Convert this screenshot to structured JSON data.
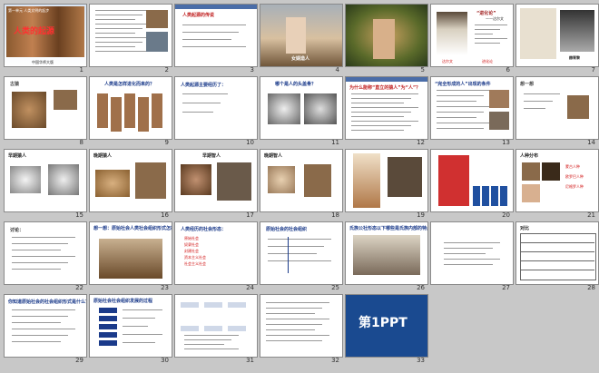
{
  "slides": [
    {
      "num": "1",
      "title": "人类的起源",
      "subtitle": "第一单元 人类文明的起步",
      "footer": "中国华师大版"
    },
    {
      "num": "2",
      "title": "",
      "lines": []
    },
    {
      "num": "3",
      "title": "人类起源的传说",
      "lines": [
        "",
        "",
        ""
      ]
    },
    {
      "num": "4",
      "caption": "女娲造人"
    },
    {
      "num": "5"
    },
    {
      "num": "6",
      "title": "“进化论”",
      "subtitle": "——达尔文",
      "caption1": "达尔文",
      "caption2": "进化论"
    },
    {
      "num": "7",
      "caption1": "",
      "caption2": "赫胥黎"
    },
    {
      "num": "8",
      "title": "古猿"
    },
    {
      "num": "9",
      "title": "人类是怎样进化而来的？"
    },
    {
      "num": "10",
      "title": "人类起源主要经历了：",
      "lines": [
        "",
        "",
        ""
      ]
    },
    {
      "num": "11",
      "title": "哪个是人的头盖骨？"
    },
    {
      "num": "12",
      "title": "为什么能称“直立的猿人”为“人”？"
    },
    {
      "num": "13",
      "title": "“完全形成的人”出现的条件"
    },
    {
      "num": "14",
      "title": "想一想",
      "lines": [
        "",
        "",
        ""
      ]
    },
    {
      "num": "15",
      "title": "早期猿人"
    },
    {
      "num": "16",
      "title": "晚期猿人"
    },
    {
      "num": "17",
      "title": "早期智人"
    },
    {
      "num": "18",
      "title": "晚期智人"
    },
    {
      "num": "19"
    },
    {
      "num": "20"
    },
    {
      "num": "21",
      "title": "人种分布",
      "lines": [
        "蒙古人种",
        "欧罗巴人种",
        "尼格罗人种"
      ]
    },
    {
      "num": "22",
      "title": "讨论："
    },
    {
      "num": "23",
      "title": "想一想：原始社会人类社会组织形式怎样？"
    },
    {
      "num": "24",
      "title": "人类经历的社会形态：",
      "lines": [
        "原始社会",
        "奴隶社会",
        "封建社会",
        "资本主义社会",
        "社会主义社会"
      ]
    },
    {
      "num": "25",
      "title": "原始社会的社会组织"
    },
    {
      "num": "26",
      "title": "氏族公社形态以下哪些是氏族内部的特点？"
    },
    {
      "num": "27"
    },
    {
      "num": "28",
      "title": "对比"
    },
    {
      "num": "29",
      "title": "你知道原始社会的社会组织形式是什么？"
    },
    {
      "num": "30",
      "title": "原始社会社会组织发展的过程"
    },
    {
      "num": "31"
    },
    {
      "num": "32"
    },
    {
      "num": "33",
      "logo": "第1PPT",
      "url": ""
    }
  ],
  "colors": {
    "bg": "#c8c8c8",
    "accent": "#1a3a8a",
    "red": "#d01010"
  }
}
